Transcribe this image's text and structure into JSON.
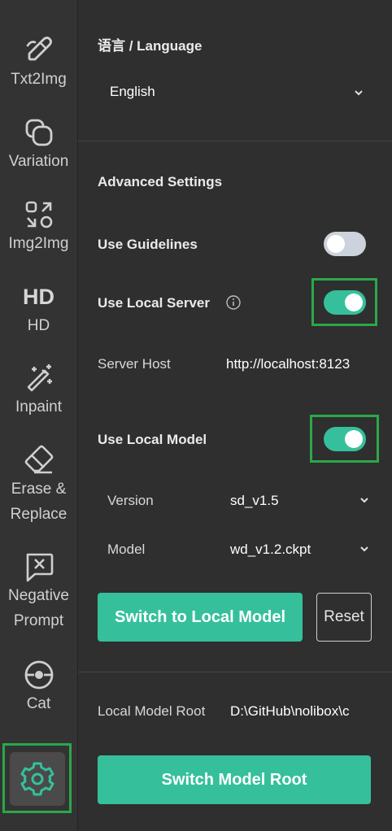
{
  "sidebar": {
    "items": [
      {
        "label": "Txt2Img",
        "icon": "brush-icon"
      },
      {
        "label": "Variation",
        "icon": "variation-icon"
      },
      {
        "label": "Img2Img",
        "icon": "img2img-icon"
      },
      {
        "label": "HD",
        "icon_text": "HD"
      },
      {
        "label": "Inpaint",
        "icon": "magic-wand-icon"
      },
      {
        "label_line1": "Erase &",
        "label_line2": "Replace",
        "icon": "eraser-icon"
      },
      {
        "label_line1": "Negative",
        "label_line2": "Prompt",
        "icon": "negative-prompt-icon"
      },
      {
        "label": "Cat",
        "icon": "pokeball-icon"
      }
    ],
    "settings_icon": "gear-icon"
  },
  "language": {
    "heading": "语言 / Language",
    "selected": "English"
  },
  "advanced": {
    "heading": "Advanced Settings",
    "use_guidelines_label": "Use Guidelines",
    "use_guidelines": false,
    "use_local_server_label": "Use Local Server",
    "use_local_server": true,
    "server_host_label": "Server Host",
    "server_host_value": "http://localhost:8123",
    "use_local_model_label": "Use Local Model",
    "use_local_model": true,
    "version_label": "Version",
    "version_value": "sd_v1.5",
    "model_label": "Model",
    "model_value": "wd_v1.2.ckpt",
    "switch_button": "Switch to Local Model",
    "reset_button": "Reset"
  },
  "model_root": {
    "label": "Local Model Root",
    "value": "D:\\GitHub\\nolibox\\c",
    "switch_button": "Switch Model Root"
  },
  "colors": {
    "accent": "#35c09b",
    "highlight": "#2aa84a",
    "background": "#2f2f2f",
    "sidebar": "#333333"
  }
}
